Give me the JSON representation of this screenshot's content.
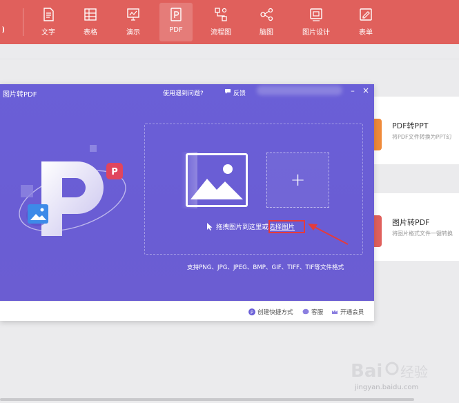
{
  "toolbar": {
    "items": [
      {
        "label": "文字",
        "icon": "document-icon"
      },
      {
        "label": "表格",
        "icon": "table-icon"
      },
      {
        "label": "演示",
        "icon": "presentation-icon"
      },
      {
        "label": "PDF",
        "icon": "pdf-icon",
        "active": true
      },
      {
        "label": "流程图",
        "icon": "flowchart-icon"
      },
      {
        "label": "脑图",
        "icon": "mindmap-icon"
      },
      {
        "label": "图片设计",
        "icon": "image-design-icon"
      },
      {
        "label": "表单",
        "icon": "form-icon"
      }
    ]
  },
  "cards": [
    {
      "title": "PDF转PPT",
      "desc": "将PDF文件转换为PPT幻",
      "accent": "#ef8a3a"
    },
    {
      "title": "图片转PDF",
      "desc": "将图片格式文件一键转换",
      "accent": "#e0605c"
    }
  ],
  "dialog": {
    "title": "图片转PDF",
    "help": "使用遇到问题?",
    "feedback": "反馈",
    "minimize": "–",
    "close": "×",
    "drop_hint": "拖拽图片到这里或",
    "choose_label": "选择图片",
    "add_symbol": "+",
    "formats": "支持PNG、JPG、JPEG、BMP、GIF、TIFF、TIF等文件格式",
    "footer": {
      "shortcut": "创建快捷方式",
      "support": "客服",
      "vip": "开通会员"
    },
    "colors": {
      "bg": "#6a5fd7",
      "highlight": "#e53b3b"
    }
  },
  "watermark": {
    "text": "jingyan.baidu.com"
  }
}
